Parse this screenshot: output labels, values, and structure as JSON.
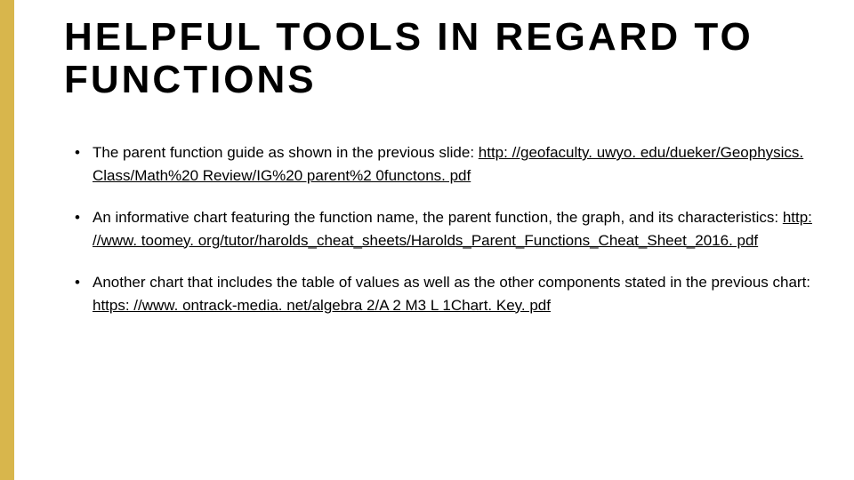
{
  "title": "HELPFUL TOOLS IN REGARD TO FUNCTIONS",
  "bullets": [
    {
      "text": "The parent function guide as shown in the previous slide: ",
      "link": "http: //geofaculty. uwyo. edu/dueker/Geophysics. Class/Math%20 Review/IG%20 parent%2 0functons. pdf"
    },
    {
      "text": "An informative chart featuring the function name, the parent function, the graph, and its characteristics: ",
      "link": "http: //www. toomey. org/tutor/harolds_cheat_sheets/Harolds_Parent_Functions_Cheat_Sheet_2016. pdf"
    },
    {
      "text": "Another chart that includes the table of values as well as the other components stated in the previous chart: ",
      "link": "https: //www. ontrack-media. net/algebra 2/A 2 M3 L 1Chart. Key. pdf"
    }
  ]
}
